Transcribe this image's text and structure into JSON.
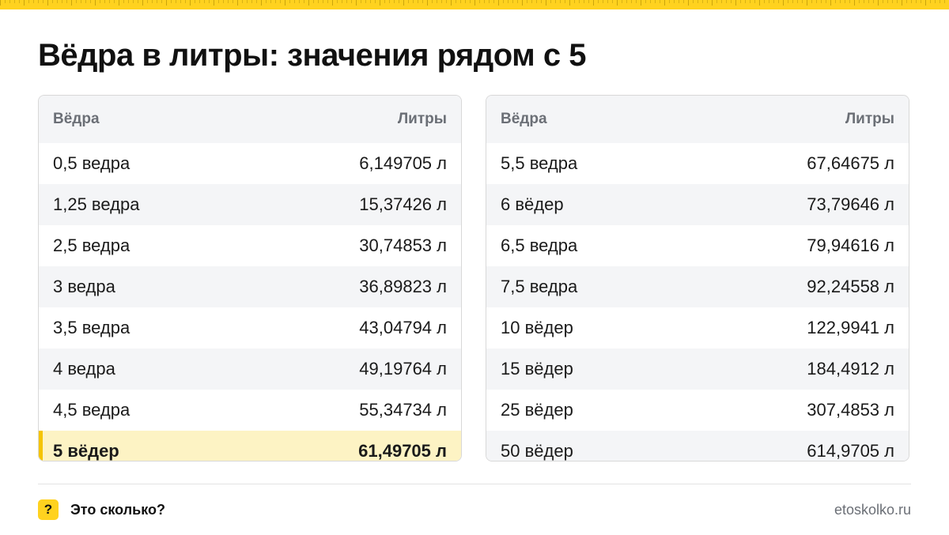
{
  "title": "Вёдра в литры: значения рядом с 5",
  "accent_color": "#ffd21f",
  "highlight_color": "#fdf3c4",
  "tables": [
    {
      "header": {
        "col1": "Вёдра",
        "col2": "Литры"
      },
      "rows": [
        {
          "label": "0,5 ведра",
          "value": "6,149705 л"
        },
        {
          "label": "1,25 ведра",
          "value": "15,37426 л"
        },
        {
          "label": "2,5 ведра",
          "value": "30,74853 л"
        },
        {
          "label": "3 ведра",
          "value": "36,89823 л"
        },
        {
          "label": "3,5 ведра",
          "value": "43,04794 л"
        },
        {
          "label": "4 ведра",
          "value": "49,19764 л"
        },
        {
          "label": "4,5 ведра",
          "value": "55,34734 л"
        },
        {
          "label": "5 вёдер",
          "value": "61,49705 л",
          "highlighted": true
        }
      ]
    },
    {
      "header": {
        "col1": "Вёдра",
        "col2": "Литры"
      },
      "rows": [
        {
          "label": "5,5 ведра",
          "value": "67,64675 л"
        },
        {
          "label": "6 вёдер",
          "value": "73,79646 л"
        },
        {
          "label": "6,5 ведра",
          "value": "79,94616 л"
        },
        {
          "label": "7,5 ведра",
          "value": "92,24558 л"
        },
        {
          "label": "10 вёдер",
          "value": "122,9941 л"
        },
        {
          "label": "15 вёдер",
          "value": "184,4912 л"
        },
        {
          "label": "25 вёдер",
          "value": "307,4853 л"
        },
        {
          "label": "50 вёдер",
          "value": "614,9705 л"
        }
      ]
    }
  ],
  "footer": {
    "icon_glyph": "?",
    "icon_name": "question-icon",
    "brand": "Это сколько?",
    "site": "etoskolko.ru"
  }
}
